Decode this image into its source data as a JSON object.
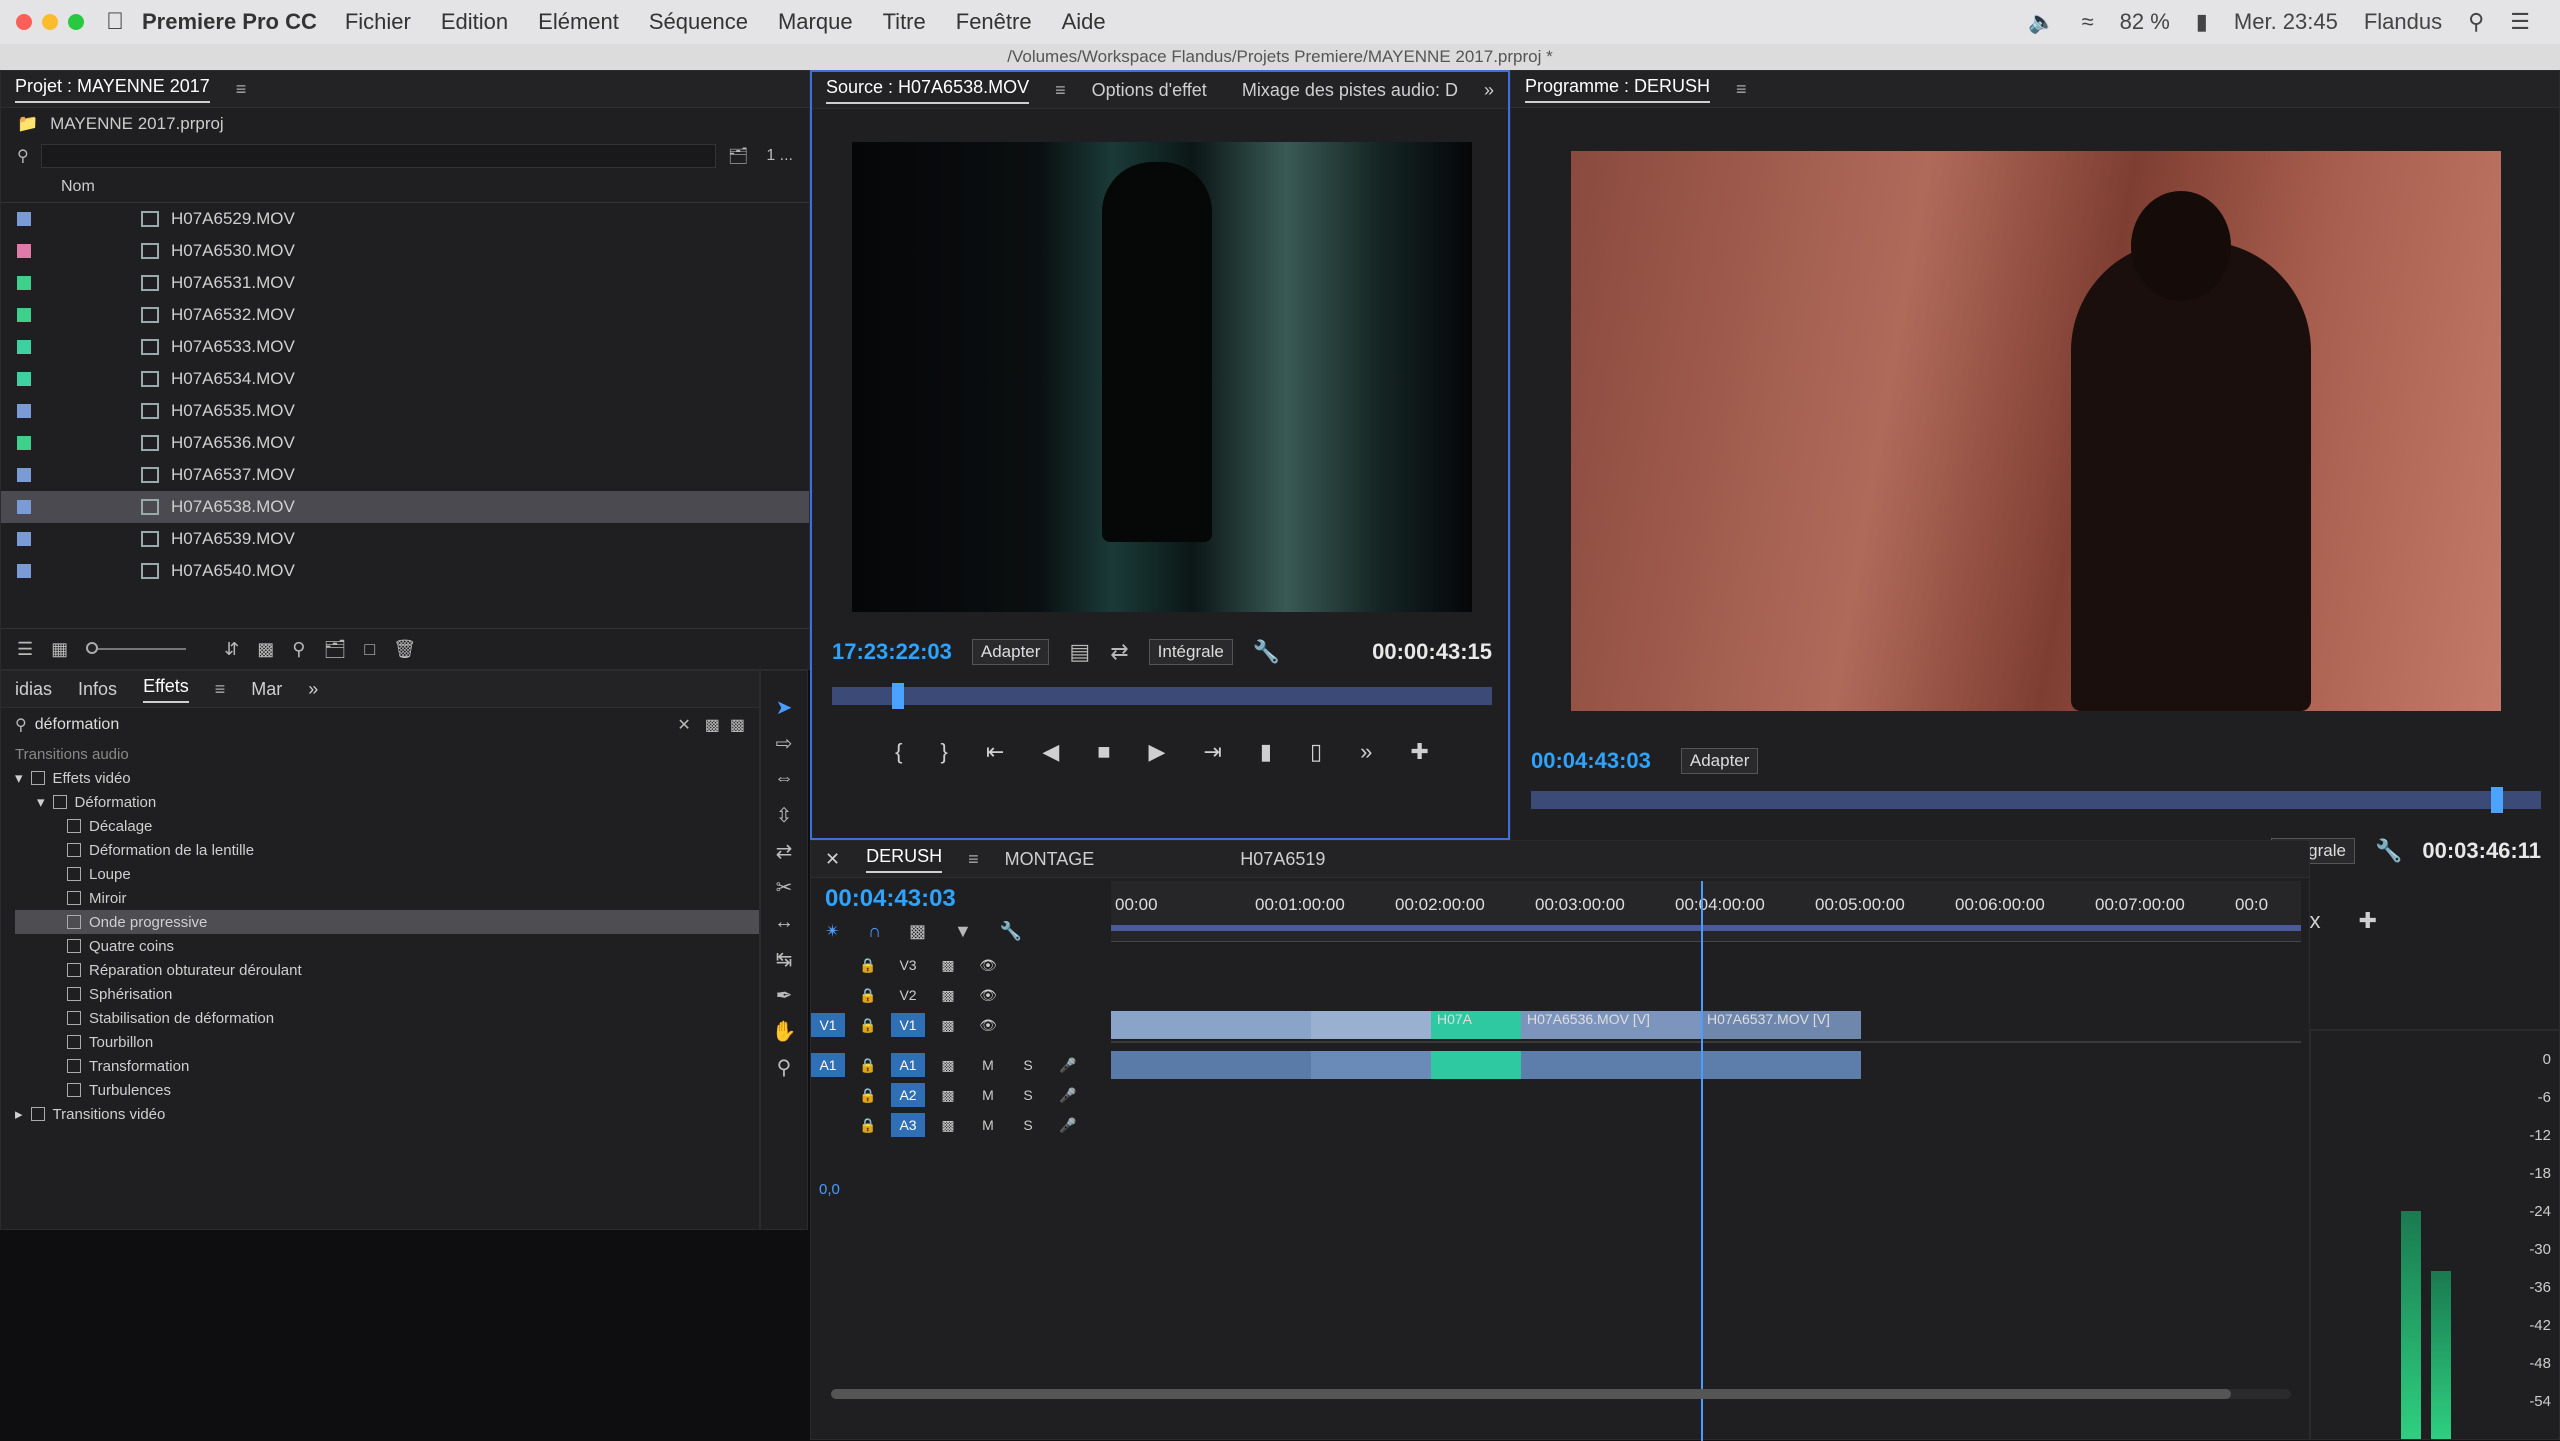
{
  "menubar": {
    "app_name": "Premiere Pro CC",
    "items": [
      "Fichier",
      "Edition",
      "Elément",
      "Séquence",
      "Marque",
      "Titre",
      "Fenêtre",
      "Aide"
    ],
    "battery": "82 %",
    "clock": "Mer. 23:45",
    "user": "Flandus"
  },
  "path": "/Volumes/Workspace Flandus/Projets Premiere/MAYENNE 2017.prproj *",
  "project": {
    "title": "Projet : MAYENNE 2017",
    "file": "MAYENNE 2017.prproj",
    "items_count": "1 ...",
    "column_name": "Nom",
    "rows": [
      {
        "name": "H07A6529.MOV",
        "color": "#7b9bd6"
      },
      {
        "name": "H07A6530.MOV",
        "color": "#e07aa8"
      },
      {
        "name": "H07A6531.MOV",
        "color": "#3ed08a"
      },
      {
        "name": "H07A6532.MOV",
        "color": "#3ed08a"
      },
      {
        "name": "H07A6533.MOV",
        "color": "#3ed0a0"
      },
      {
        "name": "H07A6534.MOV",
        "color": "#3ed0a0"
      },
      {
        "name": "H07A6535.MOV",
        "color": "#7b9bd6"
      },
      {
        "name": "H07A6536.MOV",
        "color": "#3ed08a"
      },
      {
        "name": "H07A6537.MOV",
        "color": "#7b9bd6"
      },
      {
        "name": "H07A6538.MOV",
        "color": "#7b9bd6"
      },
      {
        "name": "H07A6539.MOV",
        "color": "#7b9bd6"
      },
      {
        "name": "H07A6540.MOV",
        "color": "#7b9bd6"
      }
    ],
    "selected_row": "H07A6538.MOV"
  },
  "effects": {
    "tabs": [
      "idias",
      "Infos",
      "Effets",
      "Mar"
    ],
    "search_value": "déformation",
    "groups": {
      "audio_transitions": "Transitions audio",
      "video_effects": "Effets vidéo",
      "deformation": "Déformation",
      "video_transitions": "Transitions vidéo"
    },
    "items": [
      "Décalage",
      "Déformation de la lentille",
      "Loupe",
      "Miroir",
      "Onde progressive",
      "Quatre coins",
      "Réparation obturateur déroulant",
      "Sphérisation",
      "Stabilisation de déformation",
      "Tourbillon",
      "Transformation",
      "Turbulences"
    ],
    "selected": "Onde progressive"
  },
  "source": {
    "tab": "Source : H07A6538.MOV",
    "tab2": "Options d'effet",
    "tab3": "Mixage des pistes audio: D",
    "timecode": "17:23:22:03",
    "fit": "Adapter",
    "quality": "Intégrale",
    "duration": "00:00:43:15"
  },
  "program": {
    "tab": "Programme : DERUSH",
    "timecode": "00:04:43:03",
    "fit": "Adapter",
    "quality": "Intégrale",
    "duration": "00:03:46:11"
  },
  "timeline": {
    "tabs": [
      "DERUSH",
      "MONTAGE"
    ],
    "timecode": "00:04:43:03",
    "clip_label": "H07A6519",
    "ruler": [
      "00:00",
      "00:01:00:00",
      "00:02:00:00",
      "00:03:00:00",
      "00:04:00:00",
      "00:05:00:00",
      "00:06:00:00",
      "00:07:00:00",
      "00:0"
    ],
    "tracks": {
      "video": [
        "V3",
        "V2",
        "V1"
      ],
      "audio": [
        "A1",
        "A2",
        "A3"
      ],
      "src_v": "V1",
      "src_a": "A1",
      "m": "M",
      "s": "S"
    },
    "clips": [
      "H07A",
      "H07A6536.MOV [V]",
      "H07A6537.MOV [V]"
    ],
    "volume": "0,0"
  },
  "meter": {
    "labels": [
      "0",
      "-6",
      "-12",
      "-18",
      "-24",
      "-30",
      "-36",
      "-42",
      "-48",
      "-54"
    ]
  }
}
